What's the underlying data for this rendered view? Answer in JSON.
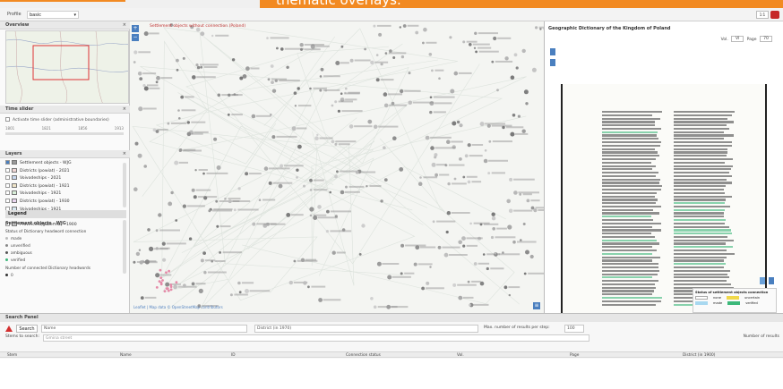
{
  "banner": {
    "text": "thematic overlays."
  },
  "topbar": {
    "profile_label": "Profile",
    "profile_value": "basic",
    "right_button": "1:1"
  },
  "overview": {
    "title": "Overview"
  },
  "time_slider": {
    "title": "Time slider",
    "checkbox_label": "Activate time slider (administrative boundaries)",
    "ticks": [
      "1801",
      "1821",
      "1856",
      "1913"
    ]
  },
  "layers": {
    "title": "Layers",
    "items": [
      "Settlement objects - WJG",
      "Districts (powiat) - 2021",
      "Voivodeships - 2021",
      "Districts (powiat) - 1921",
      "Voivodeships - 1921",
      "Districts (powiat) - 1930",
      "Voivodeships - 1921",
      "Districts (powiat) - 1930",
      "Provinces (gubernia) - 1900"
    ]
  },
  "legend": {
    "title": "Legend",
    "heading": "Settlement objects - WJG",
    "subheading": "Status of Dictionary headword connection",
    "entries": [
      "made",
      "unverified",
      "ambiguous",
      "verified"
    ],
    "footer": "Number of connected Dictionary headwords",
    "count_value": "0"
  },
  "map": {
    "title": "Settlement objects without connection (Poland)",
    "credit": "Leaflet | Map data © OpenStreetMap contributors"
  },
  "dictionary": {
    "title": "Geographic Dictionary of the Kingdom of Poland",
    "volume_label": "Vol.",
    "volume_value": "VI",
    "page_label": "Page",
    "page_value": "70",
    "connection_legend_title": "Status of settlement objects connection",
    "connection_states": [
      "none",
      "uncertain",
      "made",
      "verified"
    ]
  },
  "search": {
    "title": "Search Panel",
    "search_button": "Search",
    "name_label": "Name",
    "district_label": "District (in 1970)",
    "max_results_label": "Max. number of results per step:",
    "max_results_value": "100",
    "terms_label": "Stems to search:",
    "terms_placeholder": "Gmina street",
    "results_label": "Number of results",
    "columns": [
      "Stem",
      "Name",
      "ID",
      "Connection status",
      "Vol.",
      "Page",
      "District (in 1900)"
    ]
  },
  "colors": {
    "accent": "#f28a22",
    "map_background": "#f4f5f2",
    "ui_blue": "#4a7fbf",
    "verified_green": "#3cb87a",
    "warning_red": "#d32f2f"
  }
}
